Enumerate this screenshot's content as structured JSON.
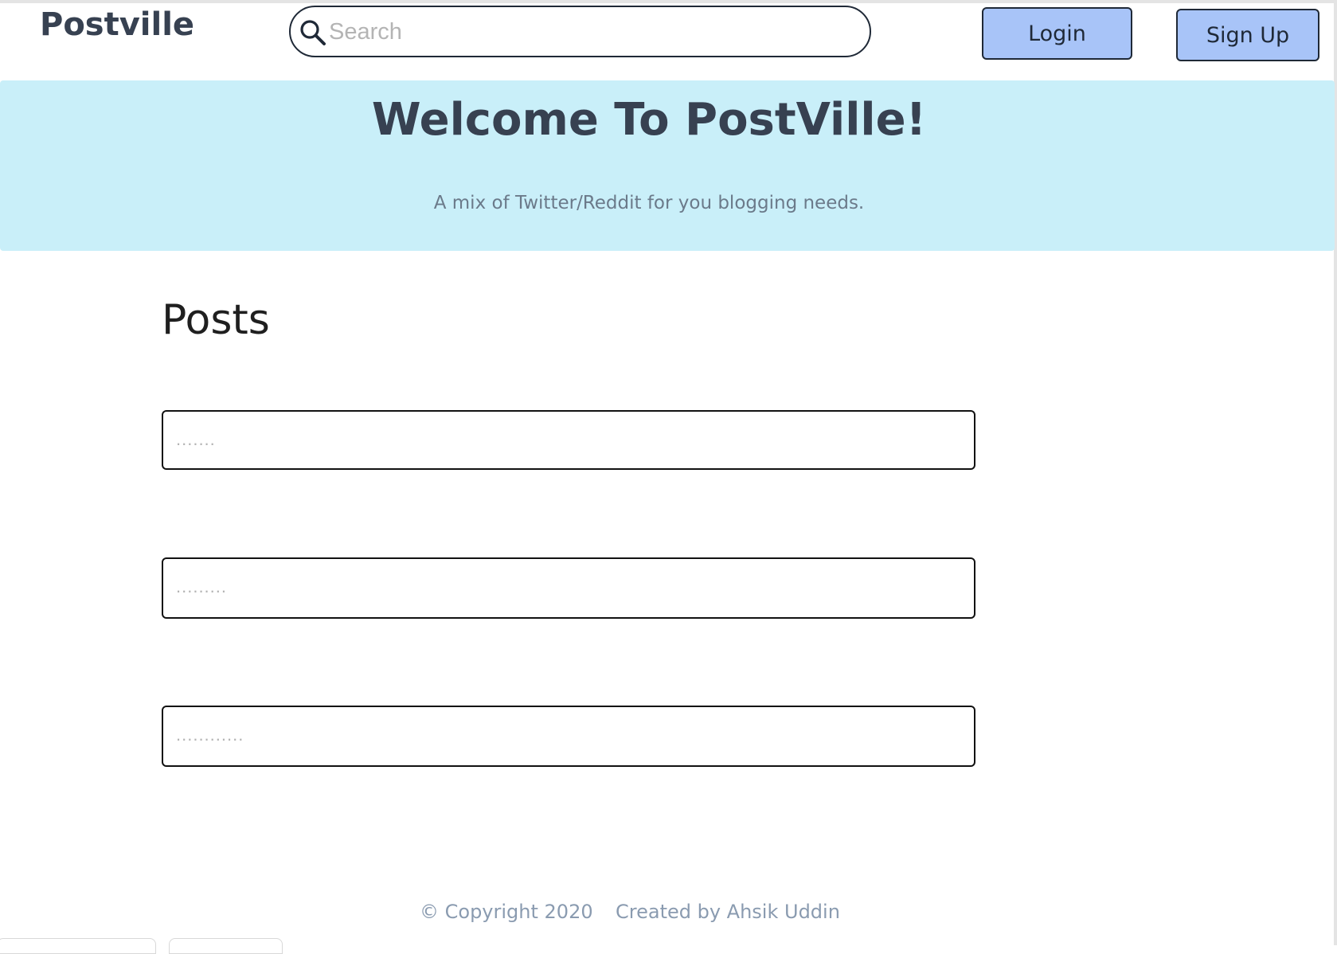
{
  "header": {
    "brand": "Postville",
    "search_placeholder": "Search",
    "login_label": "Login",
    "signup_label": "Sign Up"
  },
  "hero": {
    "title": "Welcome To PostVille!",
    "subtitle": "A mix of Twitter/Reddit for you blogging needs."
  },
  "posts": {
    "heading": "Posts",
    "fields": [
      {
        "placeholder": "......."
      },
      {
        "placeholder": "........."
      },
      {
        "placeholder": "............"
      }
    ]
  },
  "footer": {
    "copyright": "© Copyright 2020",
    "credit": "Created by Ahsik Uddin"
  },
  "colors": {
    "brand_text": "#374151",
    "button_bg": "#a8c4f8",
    "hero_bg": "#c9eff9",
    "footer_text": "#8a9bb0"
  },
  "icons": {
    "search": "search-icon"
  }
}
